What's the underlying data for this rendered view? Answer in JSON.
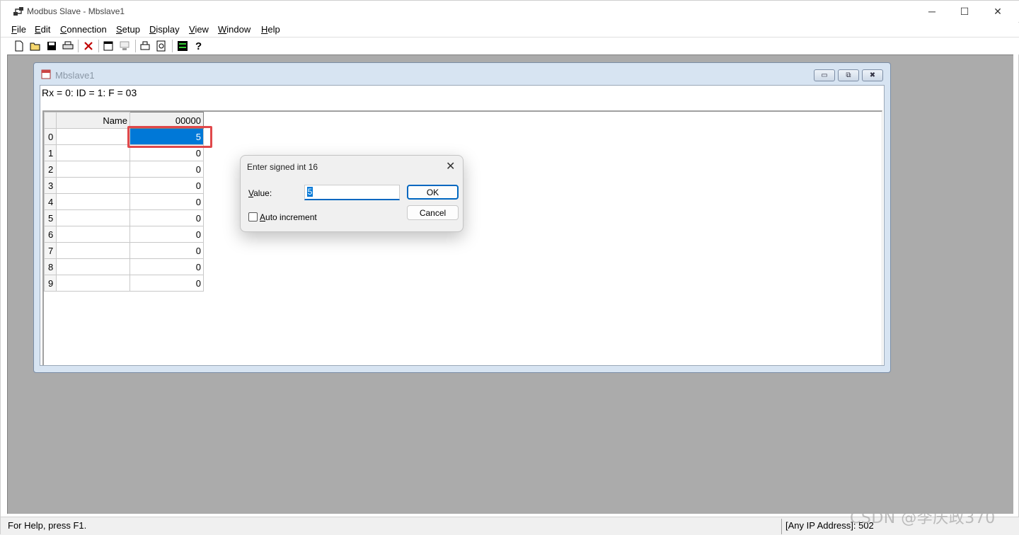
{
  "window": {
    "title": "Modbus Slave - Mbslave1"
  },
  "window_controls": {
    "minimize": "─",
    "maximize": "☐",
    "close": "✕"
  },
  "menu": [
    "File",
    "Edit",
    "Connection",
    "Setup",
    "Display",
    "View",
    "Window",
    "Help"
  ],
  "toolbar": {
    "icons": [
      "new-icon",
      "open-icon",
      "save-icon",
      "print-icon",
      "delete-icon",
      "window-icon",
      "monitor-icon",
      "printer2-icon",
      "print-preview-icon",
      "comm-icon",
      "help-icon"
    ]
  },
  "child_window": {
    "title": "Mbslave1",
    "status": "Rx = 0: ID = 1: F = 03",
    "buttons": {
      "minimize": "▭",
      "restore": "⧉",
      "close": "✖"
    }
  },
  "grid": {
    "header_name": "Name",
    "header_address": "00000",
    "rows": [
      {
        "index": "0",
        "name": "",
        "value": "5",
        "selected": true
      },
      {
        "index": "1",
        "name": "",
        "value": "0"
      },
      {
        "index": "2",
        "name": "",
        "value": "0"
      },
      {
        "index": "3",
        "name": "",
        "value": "0"
      },
      {
        "index": "4",
        "name": "",
        "value": "0"
      },
      {
        "index": "5",
        "name": "",
        "value": "0"
      },
      {
        "index": "6",
        "name": "",
        "value": "0"
      },
      {
        "index": "7",
        "name": "",
        "value": "0"
      },
      {
        "index": "8",
        "name": "",
        "value": "0"
      },
      {
        "index": "9",
        "name": "",
        "value": "0"
      }
    ]
  },
  "dialog": {
    "title": "Enter signed int 16",
    "close": "✕",
    "value_label": "Value:",
    "value": "5",
    "ok_label": "OK",
    "cancel_label": "Cancel",
    "auto_increment_label": "Auto increment",
    "auto_increment_checked": false
  },
  "statusbar": {
    "help_text": "For Help, press F1.",
    "address_text": "[Any IP Address]: 502"
  },
  "watermark": "CSDN @李庆政370",
  "colors": {
    "selection": "#0078d7",
    "highlight_box": "#e0484b",
    "mdi_background": "#ababab"
  }
}
